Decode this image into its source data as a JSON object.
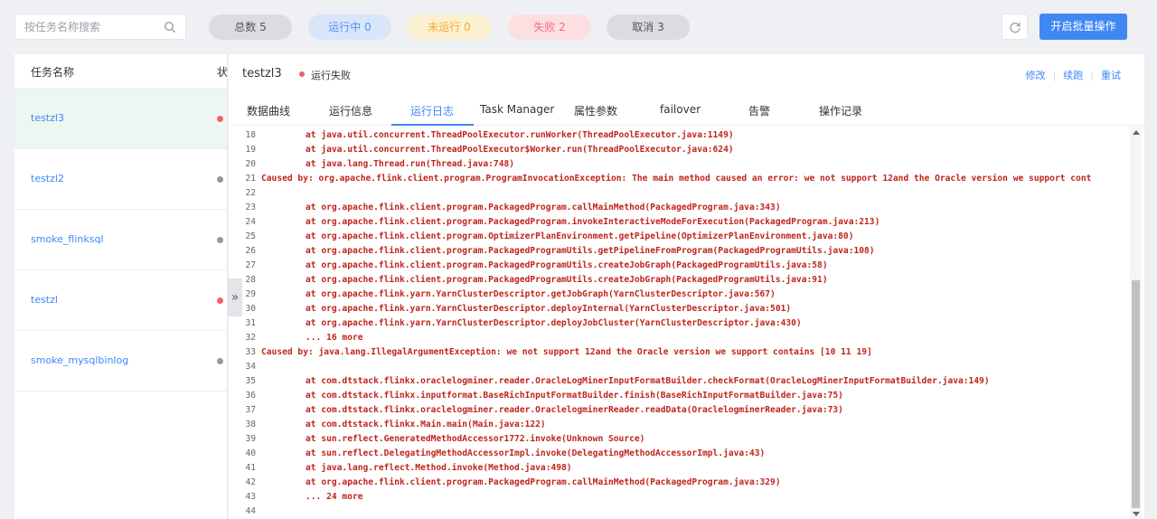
{
  "search": {
    "placeholder": "按任务名称搜索"
  },
  "filters": {
    "total": "总数 5",
    "running": "运行中 0",
    "not_running": "未运行 0",
    "failed": "失败 2",
    "cancelled": "取消 3"
  },
  "toolbar": {
    "batch_label": "开启批量操作"
  },
  "sidebar": {
    "col_name": "任务名称",
    "col_status": "状",
    "tasks": [
      {
        "name": "testzl3",
        "status_color": "#f2616a"
      },
      {
        "name": "testzl2",
        "status_color": "#999999"
      },
      {
        "name": "smoke_flinksql",
        "status_color": "#999999"
      },
      {
        "name": "testzl",
        "status_color": "#f2616a"
      },
      {
        "name": "smoke_mysqlbinlog",
        "status_color": "#999999"
      }
    ]
  },
  "collapse": {
    "glyph": "»"
  },
  "detail": {
    "job_name": "testzl3",
    "status": "运行失败",
    "actions": {
      "edit": "修改",
      "resume": "续跑",
      "retry": "重试"
    }
  },
  "tabs": [
    "数据曲线",
    "运行信息",
    "运行日志",
    "Task Manager",
    "属性参数",
    "failover",
    "告警",
    "操作记录"
  ],
  "log_lines": [
    {
      "n": "18",
      "text": "at java.util.concurrent.ThreadPoolExecutor.runWorker(ThreadPoolExecutor.java:1149)"
    },
    {
      "n": "19",
      "text": "at java.util.concurrent.ThreadPoolExecutor$Worker.run(ThreadPoolExecutor.java:624)"
    },
    {
      "n": "20",
      "text": "at java.lang.Thread.run(Thread.java:748)"
    },
    {
      "n": "21",
      "text": "Caused by: org.apache.flink.client.program.ProgramInvocationException: The main method caused an error: we not support 12and the Oracle version we support cont"
    },
    {
      "n": "22",
      "text": ""
    },
    {
      "n": "23",
      "text": "at org.apache.flink.client.program.PackagedProgram.callMainMethod(PackagedProgram.java:343)"
    },
    {
      "n": "24",
      "text": "at org.apache.flink.client.program.PackagedProgram.invokeInteractiveModeForExecution(PackagedProgram.java:213)"
    },
    {
      "n": "25",
      "text": "at org.apache.flink.client.program.OptimizerPlanEnvironment.getPipeline(OptimizerPlanEnvironment.java:80)"
    },
    {
      "n": "26",
      "text": "at org.apache.flink.client.program.PackagedProgramUtils.getPipelineFromProgram(PackagedProgramUtils.java:108)"
    },
    {
      "n": "27",
      "text": "at org.apache.flink.client.program.PackagedProgramUtils.createJobGraph(PackagedProgramUtils.java:58)"
    },
    {
      "n": "28",
      "text": "at org.apache.flink.client.program.PackagedProgramUtils.createJobGraph(PackagedProgramUtils.java:91)"
    },
    {
      "n": "29",
      "text": "at org.apache.flink.yarn.YarnClusterDescriptor.getJobGraph(YarnClusterDescriptor.java:567)"
    },
    {
      "n": "30",
      "text": "at org.apache.flink.yarn.YarnClusterDescriptor.deployInternal(YarnClusterDescriptor.java:501)"
    },
    {
      "n": "31",
      "text": "at org.apache.flink.yarn.YarnClusterDescriptor.deployJobCluster(YarnClusterDescriptor.java:430)"
    },
    {
      "n": "32",
      "text": "... 16 more"
    },
    {
      "n": "33",
      "text": "Caused by: java.lang.IllegalArgumentException: we not support 12and the Oracle version we support contains [10 11 19]"
    },
    {
      "n": "34",
      "text": ""
    },
    {
      "n": "35",
      "text": "at com.dtstack.flinkx.oraclelogminer.reader.OracleLogMinerInputFormatBuilder.checkFormat(OracleLogMinerInputFormatBuilder.java:149)"
    },
    {
      "n": "36",
      "text": "at com.dtstack.flinkx.inputformat.BaseRichInputFormatBuilder.finish(BaseRichInputFormatBuilder.java:75)"
    },
    {
      "n": "37",
      "text": "at com.dtstack.flinkx.oraclelogminer.reader.OraclelogminerReader.readData(OraclelogminerReader.java:73)"
    },
    {
      "n": "38",
      "text": "at com.dtstack.flinkx.Main.main(Main.java:122)"
    },
    {
      "n": "39",
      "text": "at sun.reflect.GeneratedMethodAccessor1772.invoke(Unknown Source)"
    },
    {
      "n": "40",
      "text": "at sun.reflect.DelegatingMethodAccessorImpl.invoke(DelegatingMethodAccessorImpl.java:43)"
    },
    {
      "n": "41",
      "text": "at java.lang.reflect.Method.invoke(Method.java:498)"
    },
    {
      "n": "42",
      "text": "at org.apache.flink.client.program.PackagedProgram.callMainMethod(PackagedProgram.java:329)"
    },
    {
      "n": "43",
      "text": "... 24 more"
    },
    {
      "n": "44",
      "text": ""
    }
  ]
}
